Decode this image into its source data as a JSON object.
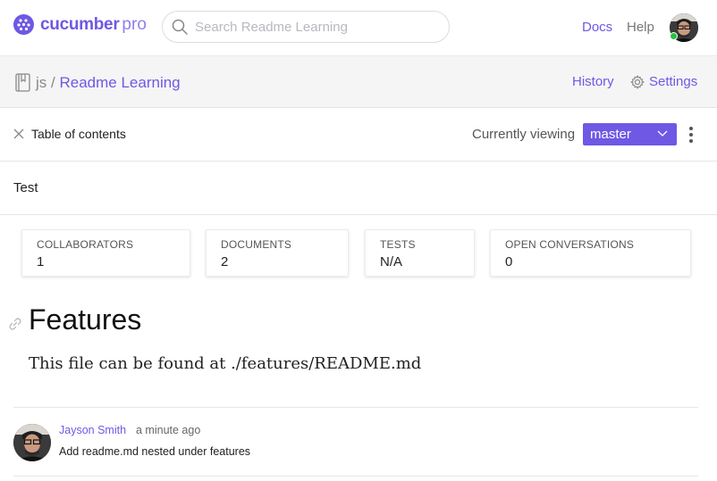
{
  "brand": {
    "name": "cucumber",
    "suffix": "pro",
    "color": "#6f58e4"
  },
  "search": {
    "placeholder": "Search Readme Learning",
    "value": ""
  },
  "nav": {
    "docs": "Docs",
    "help": "Help"
  },
  "user": {
    "status": "online",
    "status_color": "#28c23b"
  },
  "repo": {
    "owner": "js",
    "separator": "/",
    "name": "Readme Learning",
    "history_label": "History",
    "settings_label": "Settings"
  },
  "toc": {
    "label": "Table of contents"
  },
  "branch": {
    "viewing_label": "Currently viewing",
    "selected": "master"
  },
  "description": "Test",
  "stats": [
    {
      "label": "COLLABORATORS",
      "value": "1"
    },
    {
      "label": "DOCUMENTS",
      "value": "2"
    },
    {
      "label": "TESTS",
      "value": "N/A"
    },
    {
      "label": "OPEN CONVERSATIONS",
      "value": "0"
    }
  ],
  "content": {
    "heading": "Features",
    "body": "This file can be found at ./features/README.md"
  },
  "commit": {
    "author": "Jayson Smith",
    "time": "a minute ago",
    "message": "Add readme.md nested under features"
  }
}
